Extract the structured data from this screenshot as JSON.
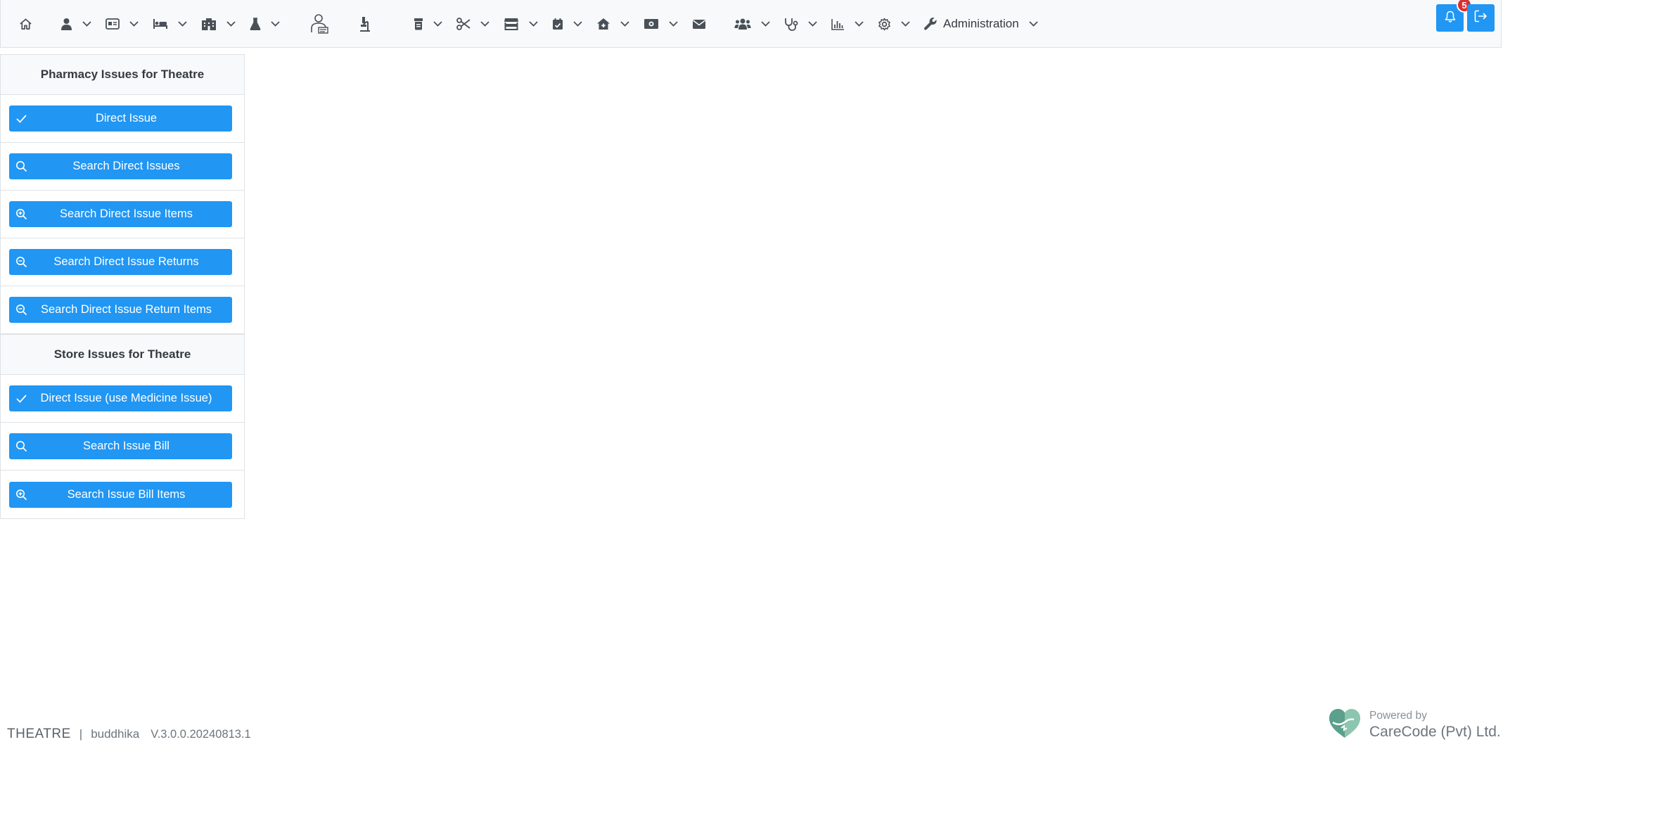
{
  "nav": {
    "items": [
      {
        "icon": "home-icon",
        "caret": false
      },
      {
        "icon": "user-icon",
        "caret": true
      },
      {
        "icon": "id-card-icon",
        "caret": true
      },
      {
        "icon": "bed-icon",
        "caret": true
      },
      {
        "icon": "building-icon",
        "caret": true
      },
      {
        "icon": "flask-icon",
        "caret": true
      },
      {
        "icon": "doctor-icon",
        "caret": false
      },
      {
        "icon": "microscope-icon",
        "caret": false
      },
      {
        "icon": "prescription-bottle-icon",
        "caret": true
      },
      {
        "icon": "scissors-icon",
        "caret": true
      },
      {
        "icon": "store-icon",
        "caret": true
      },
      {
        "icon": "calendar-check-icon",
        "caret": true
      },
      {
        "icon": "house-medical-icon",
        "caret": true
      },
      {
        "icon": "money-icon",
        "caret": true
      },
      {
        "icon": "envelope-icon",
        "caret": false
      },
      {
        "icon": "users-icon",
        "caret": true
      },
      {
        "icon": "stethoscope-icon",
        "caret": true
      },
      {
        "icon": "bar-chart-icon",
        "caret": true
      },
      {
        "icon": "gear-icon",
        "caret": true
      }
    ],
    "admin_label": "Administration",
    "notification_count": "5"
  },
  "pharmacy": {
    "title": "Pharmacy Issues for Theatre",
    "buttons": [
      {
        "label": "Direct Issue",
        "icon": "check-icon"
      },
      {
        "label": "Search Direct Issues",
        "icon": "search-icon"
      },
      {
        "label": "Search Direct Issue Items",
        "icon": "zoom-in-icon"
      },
      {
        "label": "Search Direct Issue Returns",
        "icon": "zoom-out-icon"
      },
      {
        "label": "Search Direct Issue Return Items",
        "icon": "zoom-out-icon"
      }
    ]
  },
  "store": {
    "title": "Store Issues for Theatre",
    "buttons": [
      {
        "label": "Direct Issue (use Medicine Issue)",
        "icon": "check-icon"
      },
      {
        "label": "Search Issue Bill",
        "icon": "search-icon"
      },
      {
        "label": "Search Issue Bill Items",
        "icon": "zoom-in-icon"
      }
    ]
  },
  "footer": {
    "department": "THEATRE",
    "separator": "|",
    "user": "buddhika",
    "version": "V.3.0.0.20240813.1",
    "powered_by": "Powered by",
    "company": "CareCode (Pvt) Ltd."
  },
  "colors": {
    "primary": "#2196f3",
    "badge": "#dc2f2f",
    "navbar_bg": "#f8f9fa",
    "border": "#dee2e6"
  }
}
